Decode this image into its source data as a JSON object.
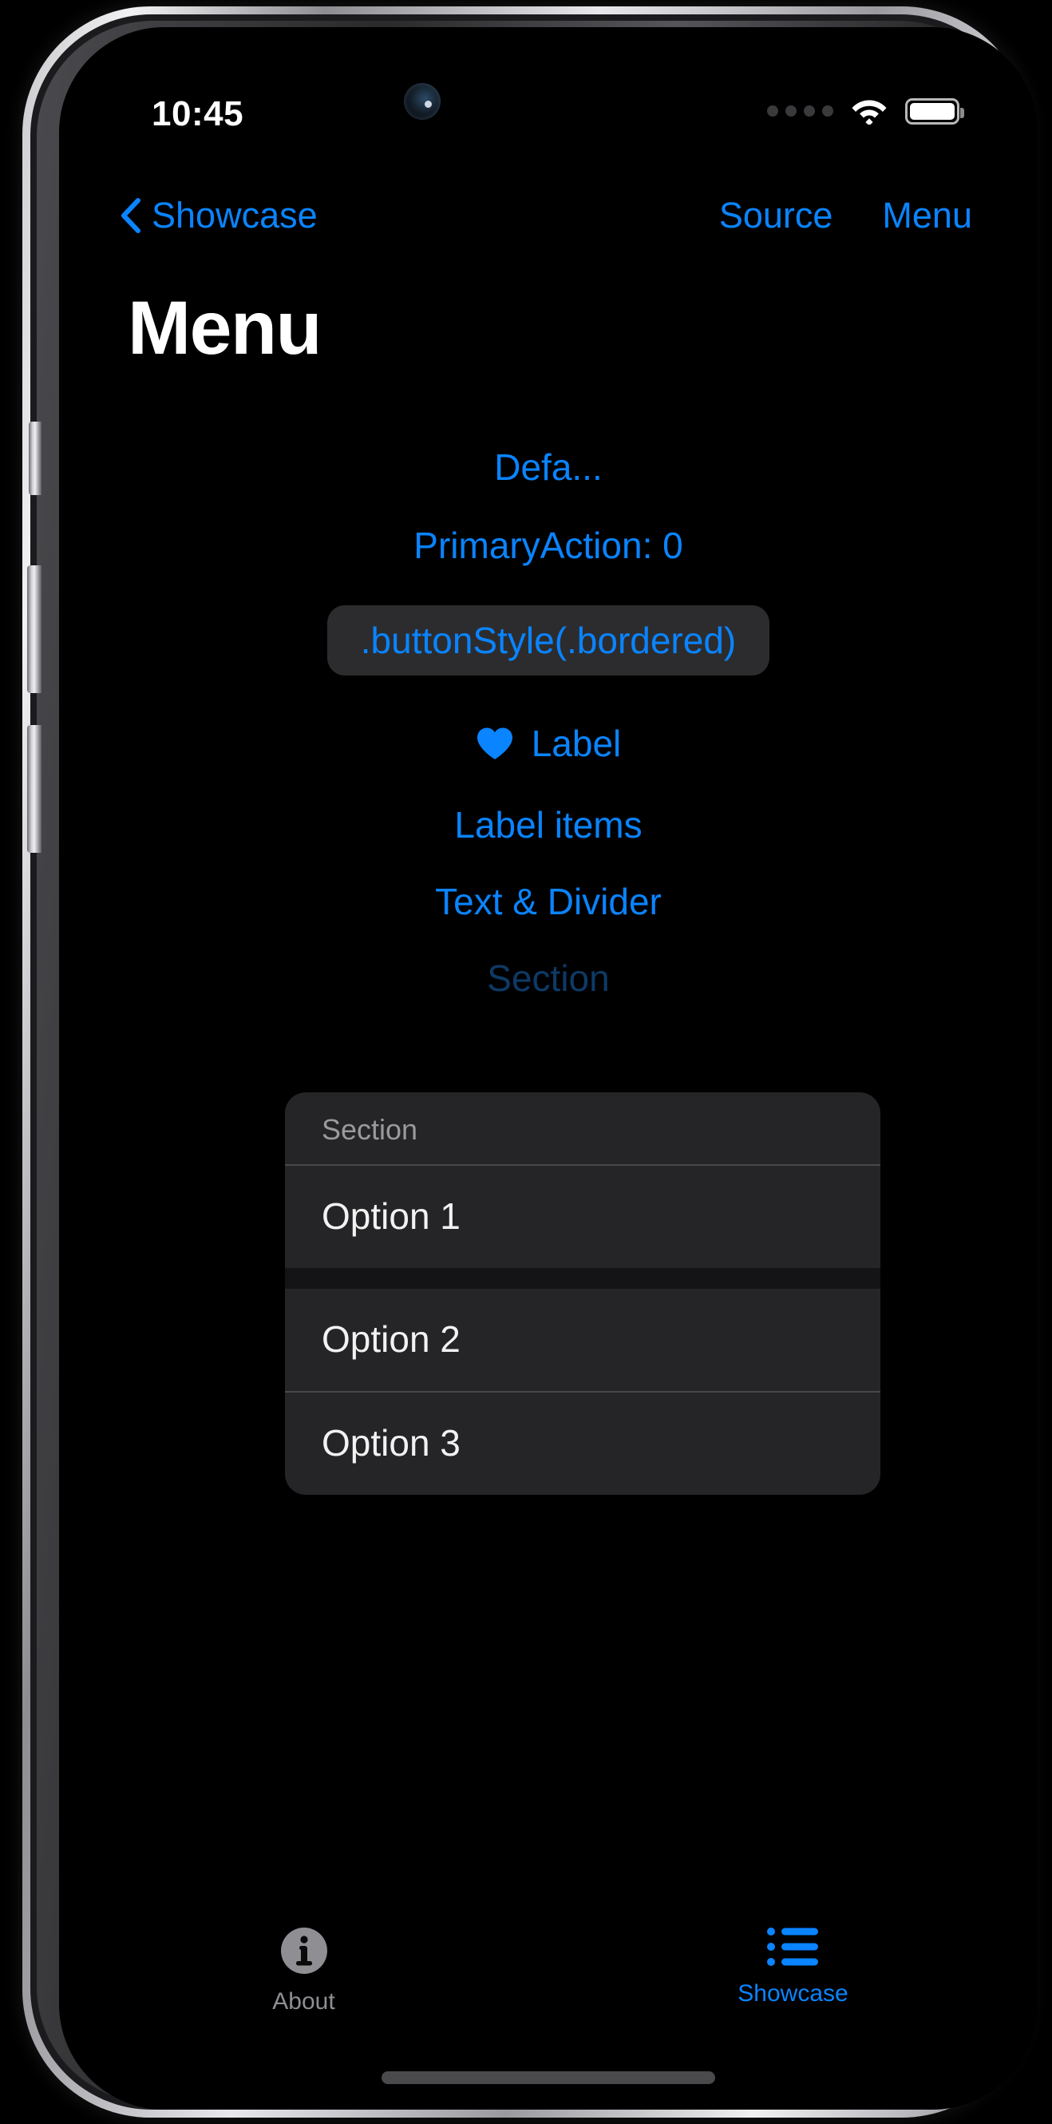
{
  "status_bar": {
    "time": "10:45",
    "cellular_icon": "signal-dots-icon",
    "wifi_icon": "wifi-icon",
    "battery_icon": "battery-full-icon"
  },
  "nav_bar": {
    "back_icon": "chevron-left-icon",
    "back_label": "Showcase",
    "source_label": "Source",
    "menu_label": "Menu"
  },
  "page_title": "Menu",
  "menu_items": {
    "default": "Defa...",
    "primary_action": "PrimaryAction: 0",
    "bordered": ".buttonStyle(.bordered)",
    "label": "Label",
    "label_icon": "heart-fill-icon",
    "label_items": "Label items",
    "text_divider": "Text & Divider",
    "section": "Section"
  },
  "popup": {
    "section_header": "Section",
    "options": [
      "Option 1",
      "Option 2",
      "Option 3"
    ]
  },
  "tab_bar": {
    "tabs": [
      {
        "label": "About",
        "icon": "info-circle-fill-icon",
        "active": false
      },
      {
        "label": "Showcase",
        "icon": "list-bullet-icon",
        "active": true
      }
    ]
  },
  "colors": {
    "accent_blue": "#0a84ff",
    "dimmed_blue": "#0d3a66",
    "inactive_gray": "#8e8e93",
    "popup_bg": "#252527",
    "chip_bg": "#2c2c2e",
    "screen_bg": "#000000"
  }
}
